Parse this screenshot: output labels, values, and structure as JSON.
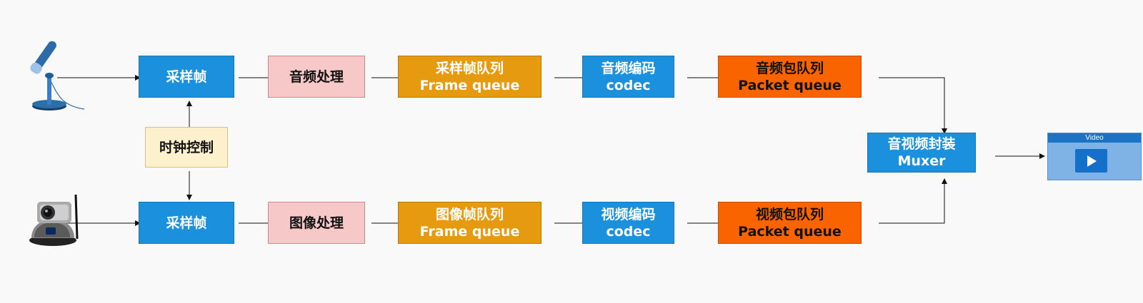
{
  "nodes": {
    "audio_sample": "采样帧",
    "audio_process": "音频处理",
    "audio_queue": [
      "采样帧队列",
      "Frame queue"
    ],
    "audio_codec": [
      "音频编码",
      "codec"
    ],
    "audio_packet": [
      "音频包队列",
      "Packet queue"
    ],
    "clock": "时钟控制",
    "video_sample": "采样帧",
    "video_process": "图像处理",
    "video_queue": [
      "图像帧队列",
      "Frame queue"
    ],
    "video_codec": [
      "视频编码",
      "codec"
    ],
    "video_packet": [
      "视频包队列",
      "Packet queue"
    ],
    "muxer": [
      "音视频封装",
      "Muxer"
    ]
  },
  "output": {
    "title": "Video",
    "icon": "play-icon"
  },
  "sources": {
    "audio_icon": "microphone-icon",
    "video_icon": "webcam-icon"
  },
  "colors": {
    "blue": "#1b90dc",
    "pink": "#f6c9c8",
    "orange": "#e69a10",
    "red": "#fa6400",
    "cream": "#fdf1cd"
  }
}
